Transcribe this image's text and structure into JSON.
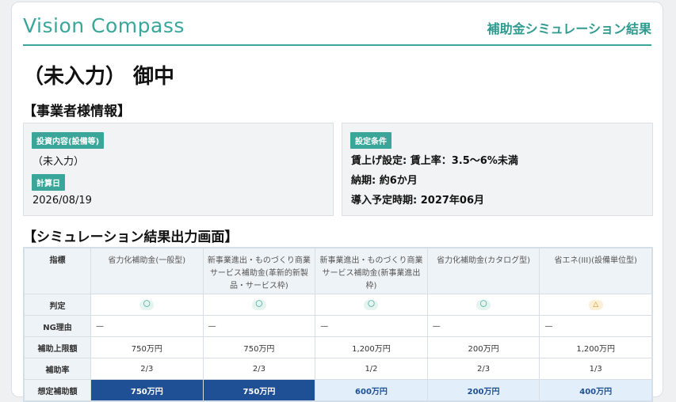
{
  "header": {
    "logo": "Vision Compass",
    "title": "補助金シミュレーション結果"
  },
  "recipient": "（未入力） 御中",
  "business_info": {
    "section_title": "【事業者様情報】",
    "investment_tag": "投資内容(設備等)",
    "investment_value": "（未入力）",
    "date_tag": "計算日",
    "date_value": "2026/08/19",
    "conditions_tag": "設定条件",
    "conditions": [
      "賃上げ設定: 賃上率：3.5〜6%未満",
      "納期: 約6か月",
      "導入予定時期: 2027年06月"
    ]
  },
  "simulation": {
    "section_title": "【シミュレーション結果出力画面】",
    "metric_header": "指標",
    "columns": [
      "省力化補助金(一般型)",
      "新事業進出・ものづくり商業サービス補助金(革新的新製品・サービス枠)",
      "新事業進出・ものづくり商業サービス補助金(新事業進出枠)",
      "省力化補助金(カタログ型)",
      "省エネ(III)(設備単位型)"
    ],
    "rows": [
      {
        "label": "判定",
        "cells": [
          "〇",
          "〇",
          "〇",
          "〇",
          "△"
        ]
      },
      {
        "label": "NG理由",
        "cells": [
          "—",
          "—",
          "—",
          "—",
          "—"
        ]
      },
      {
        "label": "補助上限額",
        "cells": [
          "750万円",
          "750万円",
          "1,200万円",
          "200万円",
          "1,200万円"
        ]
      },
      {
        "label": "補助率",
        "cells": [
          "2/3",
          "2/3",
          "1/2",
          "2/3",
          "1/3"
        ]
      },
      {
        "label": "想定補助額",
        "cells": [
          "750万円",
          "750万円",
          "600万円",
          "200万円",
          "400万円"
        ]
      }
    ]
  },
  "colors": {
    "accent": "#3aa69a",
    "highlight_dark": "#1f4f95",
    "highlight_light": "#e2effa",
    "judgment_ok": "#3aa69a",
    "judgment_warn": "#c8901c"
  }
}
